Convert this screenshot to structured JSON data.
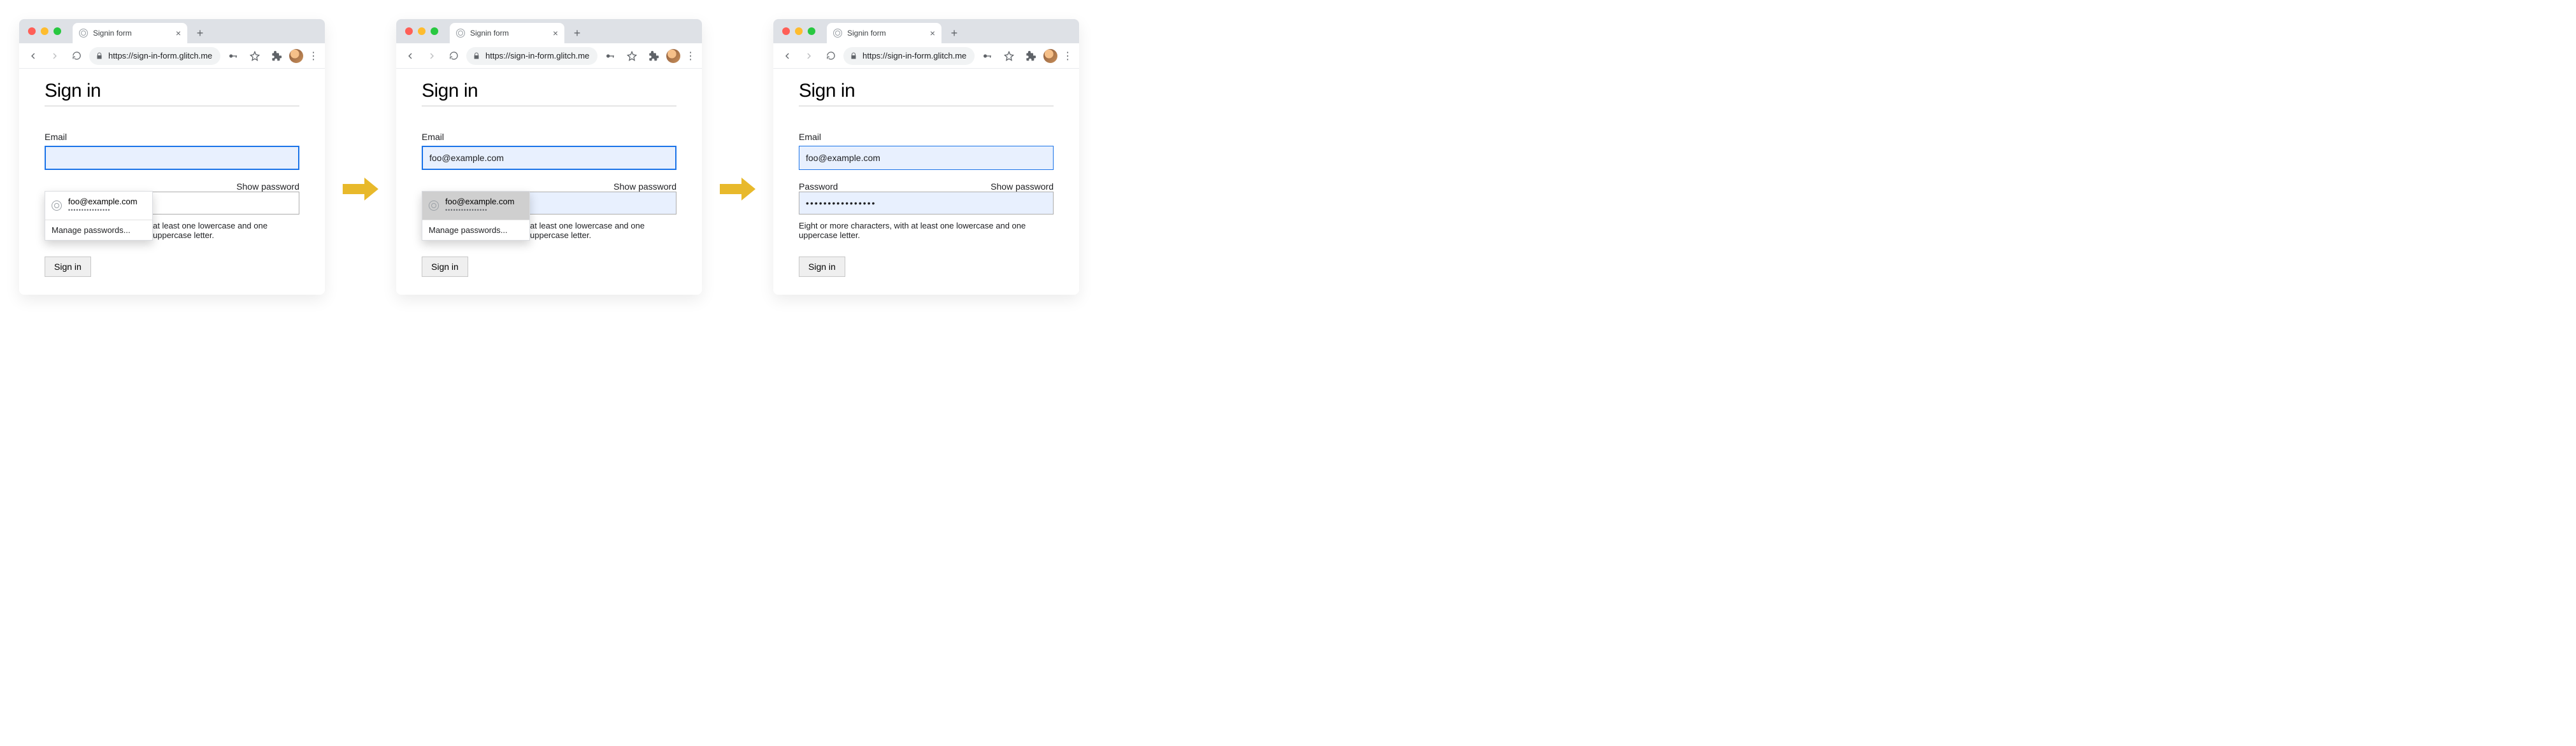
{
  "browser": {
    "tab_title": "Signin form",
    "url_display": "https://sign-in-form.glitch.me"
  },
  "page": {
    "heading": "Sign in",
    "email_label": "Email",
    "password_label": "Password",
    "show_password": "Show password",
    "helper": "Eight or more characters, with at least one lowercase and one uppercase letter.",
    "submit": "Sign in"
  },
  "autofill": {
    "suggestion_email": "foo@example.com",
    "suggestion_password_mask": "••••••••••••••••",
    "manage": "Manage passwords..."
  },
  "state1": {
    "email_value": "",
    "password_value": ""
  },
  "state2": {
    "email_value": "foo@example.com",
    "password_value": ""
  },
  "state3": {
    "email_value": "foo@example.com",
    "password_mask": "••••••••••••••••"
  }
}
